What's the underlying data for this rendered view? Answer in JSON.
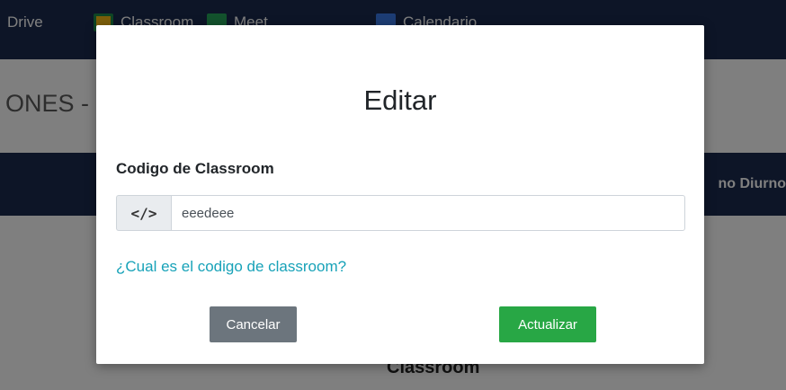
{
  "nav": {
    "items": [
      {
        "label": "Drive",
        "icon": "drive-icon"
      },
      {
        "label": "Classroom",
        "icon": "classroom-icon"
      },
      {
        "label": "Meet",
        "icon": "meet-icon"
      },
      {
        "label": "Calendario",
        "icon": "calendar-icon"
      }
    ]
  },
  "background": {
    "heading": "ONES -",
    "section_bar_text": "no Diurno",
    "bottom_title": "Classroom"
  },
  "modal": {
    "title": "Editar",
    "field_label": "Codigo de Classroom",
    "input": {
      "addon_icon": "code-icon",
      "addon_text": "</>",
      "value": "eeedeee",
      "placeholder": ""
    },
    "help_link": "¿Cual es el codigo de classroom?",
    "cancel_label": "Cancelar",
    "update_label": "Actualizar"
  },
  "colors": {
    "nav_background": "#1b2b4f",
    "cancel_button": "#6c757d",
    "update_button": "#28a745",
    "link": "#17a2b8"
  }
}
